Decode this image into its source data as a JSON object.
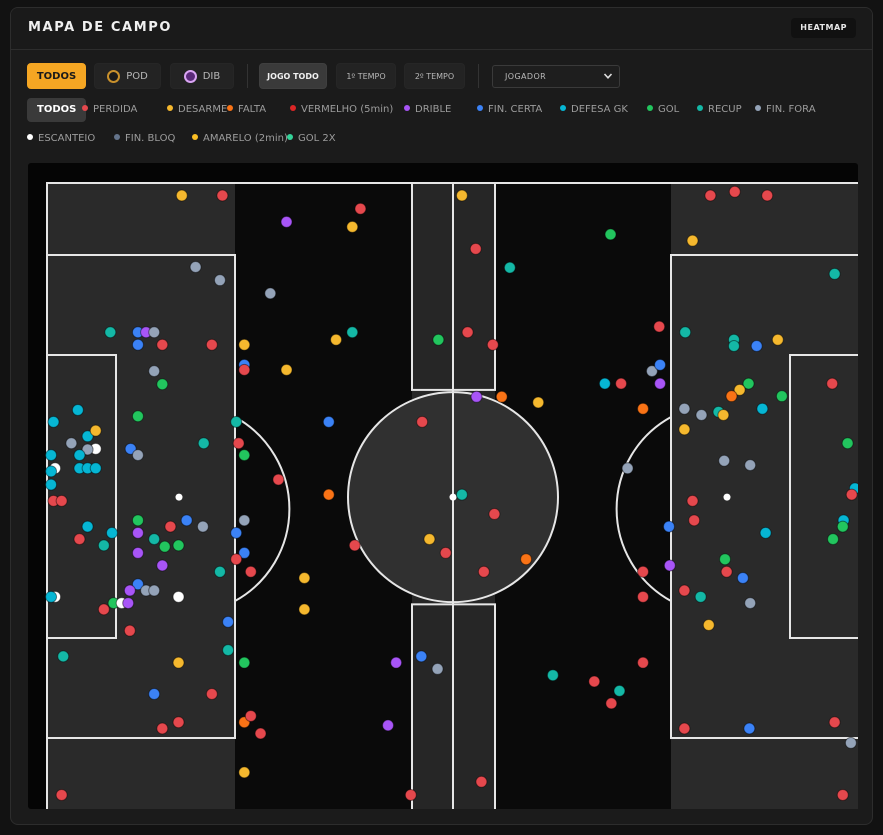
{
  "header": {
    "title": "MAPA DE CAMPO",
    "heatmap_label": "HEATMAP"
  },
  "teams": [
    {
      "label": "TODOS",
      "active": true
    },
    {
      "label": "POD",
      "active": false,
      "logo_color": "#c8902c"
    },
    {
      "label": "DIB",
      "active": false,
      "logo_color": "#b06ad8"
    }
  ],
  "periods": [
    {
      "label": "JOGO TODO",
      "active": true
    },
    {
      "label": "1º TEMPO",
      "active": false
    },
    {
      "label": "2º TEMPO",
      "active": false
    }
  ],
  "player_select": {
    "value": "JOGADOR"
  },
  "filters": [
    {
      "label": "TODOS",
      "active": true
    },
    {
      "label": "PERDIDA",
      "color": "#e5484d"
    },
    {
      "label": "DESARME",
      "color": "#f5b82e"
    },
    {
      "label": "FALTA",
      "color": "#f97316"
    },
    {
      "label": "VERMELHO (5min)",
      "color": "#dc2626"
    },
    {
      "label": "DRIBLE",
      "color": "#a855f7"
    },
    {
      "label": "FIN. CERTA",
      "color": "#3b82f6"
    },
    {
      "label": "DEFESA GK",
      "color": "#06b6d4"
    },
    {
      "label": "GOL",
      "color": "#22c55e"
    },
    {
      "label": "RECUP",
      "color": "#14b8a6"
    },
    {
      "label": "FIN. FORA",
      "color": "#94a3b8"
    },
    {
      "label": "ESCANTEIO",
      "color": "#ffffff"
    },
    {
      "label": "FIN. BLOQ",
      "color": "#64748b"
    },
    {
      "label": "AMARELO (2min)",
      "color": "#fbbf24"
    },
    {
      "label": "GOL 2X",
      "color": "#34d399"
    }
  ],
  "colors": {
    "perdida": "#e5484d",
    "desarme": "#f5b82e",
    "falta": "#f97316",
    "drible": "#a855f7",
    "fin_certa": "#3b82f6",
    "defesa_gk": "#06b6d4",
    "gol": "#22c55e",
    "recup": "#14b8a6",
    "fin_fora": "#94a3b8",
    "escanteio": "#ffffff",
    "fin_bloq": "#64748b",
    "amarelo": "#fbbf24",
    "gol2x": "#34d399"
  },
  "events": [
    [
      "desarme",
      0.166,
      0.02
    ],
    [
      "perdida",
      0.216,
      0.02
    ],
    [
      "drible",
      0.295,
      0.062
    ],
    [
      "perdida",
      0.386,
      0.041
    ],
    [
      "desarme",
      0.376,
      0.07
    ],
    [
      "desarme",
      0.511,
      0.02
    ],
    [
      "perdida",
      0.528,
      0.105
    ],
    [
      "recup",
      0.57,
      0.135
    ],
    [
      "gol",
      0.694,
      0.082
    ],
    [
      "perdida",
      0.817,
      0.02
    ],
    [
      "perdida",
      0.847,
      0.014
    ],
    [
      "perdida",
      0.887,
      0.02
    ],
    [
      "desarme",
      0.795,
      0.092
    ],
    [
      "recup",
      0.97,
      0.145
    ],
    [
      "fin_fora",
      0.183,
      0.134
    ],
    [
      "fin_fora",
      0.213,
      0.155
    ],
    [
      "fin_fora",
      0.275,
      0.176
    ],
    [
      "recup",
      0.078,
      0.238
    ],
    [
      "fin_certa",
      0.112,
      0.238
    ],
    [
      "drible",
      0.122,
      0.238
    ],
    [
      "fin_fora",
      0.132,
      0.238
    ],
    [
      "fin_certa",
      0.112,
      0.258
    ],
    [
      "perdida",
      0.142,
      0.258
    ],
    [
      "perdida",
      0.203,
      0.258
    ],
    [
      "desarme",
      0.243,
      0.258
    ],
    [
      "desarme",
      0.356,
      0.25
    ],
    [
      "recup",
      0.376,
      0.238
    ],
    [
      "gol",
      0.482,
      0.25
    ],
    [
      "perdida",
      0.518,
      0.238
    ],
    [
      "perdida",
      0.549,
      0.258
    ],
    [
      "perdida",
      0.754,
      0.229
    ],
    [
      "recup",
      0.786,
      0.238
    ],
    [
      "recup",
      0.846,
      0.25
    ],
    [
      "recup",
      0.846,
      0.26
    ],
    [
      "fin_certa",
      0.874,
      0.26
    ],
    [
      "desarme",
      0.9,
      0.25
    ],
    [
      "fin_certa",
      0.243,
      0.29
    ],
    [
      "perdida",
      0.243,
      0.298
    ],
    [
      "desarme",
      0.295,
      0.298
    ],
    [
      "fin_fora",
      0.132,
      0.3
    ],
    [
      "gol",
      0.142,
      0.321
    ],
    [
      "defesa_gk",
      0.687,
      0.32
    ],
    [
      "perdida",
      0.707,
      0.32
    ],
    [
      "fin_fora",
      0.745,
      0.3
    ],
    [
      "fin_certa",
      0.755,
      0.29
    ],
    [
      "drible",
      0.755,
      0.32
    ],
    [
      "gol",
      0.864,
      0.32
    ],
    [
      "desarme",
      0.853,
      0.33
    ],
    [
      "falta",
      0.843,
      0.34
    ],
    [
      "gol",
      0.905,
      0.34
    ],
    [
      "perdida",
      0.967,
      0.32
    ],
    [
      "drible",
      0.529,
      0.341
    ],
    [
      "falta",
      0.56,
      0.341
    ],
    [
      "desarme",
      0.605,
      0.35
    ],
    [
      "defesa_gk",
      0.008,
      0.381
    ],
    [
      "defesa_gk",
      0.038,
      0.362
    ],
    [
      "gol",
      0.112,
      0.372
    ],
    [
      "recup",
      0.233,
      0.381
    ],
    [
      "fin_certa",
      0.347,
      0.381
    ],
    [
      "perdida",
      0.462,
      0.381
    ],
    [
      "falta",
      0.734,
      0.36
    ],
    [
      "fin_fora",
      0.785,
      0.36
    ],
    [
      "fin_fora",
      0.806,
      0.37
    ],
    [
      "recup",
      0.827,
      0.365
    ],
    [
      "desarme",
      0.833,
      0.37
    ],
    [
      "defesa_gk",
      0.881,
      0.36
    ],
    [
      "escanteio",
      0.06,
      0.424
    ],
    [
      "defesa_gk",
      0.05,
      0.404
    ],
    [
      "fin_fora",
      0.03,
      0.415
    ],
    [
      "fin_fora",
      0.05,
      0.425
    ],
    [
      "desarme",
      0.06,
      0.395
    ],
    [
      "recup",
      0.193,
      0.415
    ],
    [
      "perdida",
      0.236,
      0.415
    ],
    [
      "fin_certa",
      0.103,
      0.424
    ],
    [
      "fin_fora",
      0.112,
      0.434
    ],
    [
      "gol",
      0.243,
      0.434
    ],
    [
      "defesa_gk",
      0.005,
      0.434
    ],
    [
      "defesa_gk",
      0.04,
      0.434
    ],
    [
      "defesa_gk",
      0.04,
      0.455
    ],
    [
      "defesa_gk",
      0.05,
      0.455
    ],
    [
      "defesa_gk",
      0.06,
      0.455
    ],
    [
      "escanteio",
      0.01,
      0.455
    ],
    [
      "defesa_gk",
      0.005,
      0.46
    ],
    [
      "fin_fora",
      0.715,
      0.455
    ],
    [
      "fin_fora",
      0.834,
      0.443
    ],
    [
      "fin_fora",
      0.866,
      0.45
    ],
    [
      "desarme",
      0.785,
      0.393
    ],
    [
      "gol",
      0.986,
      0.415
    ],
    [
      "perdida",
      0.285,
      0.473
    ],
    [
      "falta",
      0.347,
      0.497
    ],
    [
      "recup",
      0.511,
      0.497
    ],
    [
      "perdida",
      0.551,
      0.528
    ],
    [
      "perdida",
      0.795,
      0.507
    ],
    [
      "perdida",
      0.797,
      0.538
    ],
    [
      "defesa_gk",
      0.995,
      0.487
    ],
    [
      "perdida",
      0.991,
      0.497
    ],
    [
      "defesa_gk",
      0.005,
      0.481
    ],
    [
      "perdida",
      0.008,
      0.507
    ],
    [
      "perdida",
      0.018,
      0.507
    ],
    [
      "defesa_gk",
      0.05,
      0.548
    ],
    [
      "fin_certa",
      0.172,
      0.538
    ],
    [
      "fin_fora",
      0.192,
      0.548
    ],
    [
      "fin_certa",
      0.233,
      0.558
    ],
    [
      "fin_fora",
      0.243,
      0.538
    ],
    [
      "perdida",
      0.152,
      0.548
    ],
    [
      "gol",
      0.112,
      0.538
    ],
    [
      "drible",
      0.112,
      0.558
    ],
    [
      "defesa_gk",
      0.08,
      0.558
    ],
    [
      "recup",
      0.07,
      0.578
    ],
    [
      "perdida",
      0.04,
      0.568
    ],
    [
      "gol",
      0.162,
      0.578
    ],
    [
      "recup",
      0.132,
      0.568
    ],
    [
      "gol",
      0.145,
      0.58
    ],
    [
      "drible",
      0.112,
      0.59
    ],
    [
      "desarme",
      0.471,
      0.568
    ],
    [
      "perdida",
      0.379,
      0.578
    ],
    [
      "fin_certa",
      0.766,
      0.548
    ],
    [
      "defesa_gk",
      0.885,
      0.558
    ],
    [
      "defesa_gk",
      0.981,
      0.538
    ],
    [
      "gol",
      0.98,
      0.548
    ],
    [
      "gol",
      0.968,
      0.568
    ],
    [
      "fin_certa",
      0.243,
      0.59
    ],
    [
      "drible",
      0.142,
      0.61
    ],
    [
      "perdida",
      0.233,
      0.6
    ],
    [
      "perdida",
      0.251,
      0.62
    ],
    [
      "recup",
      0.213,
      0.62
    ],
    [
      "desarme",
      0.317,
      0.63
    ],
    [
      "perdida",
      0.491,
      0.59
    ],
    [
      "perdida",
      0.538,
      0.62
    ],
    [
      "falta",
      0.59,
      0.6
    ],
    [
      "drible",
      0.767,
      0.61
    ],
    [
      "perdida",
      0.734,
      0.62
    ],
    [
      "gol",
      0.835,
      0.6
    ],
    [
      "perdida",
      0.837,
      0.62
    ],
    [
      "fin_certa",
      0.857,
      0.63
    ],
    [
      "fin_certa",
      0.112,
      0.64
    ],
    [
      "fin_fora",
      0.122,
      0.65
    ],
    [
      "fin_fora",
      0.132,
      0.65
    ],
    [
      "drible",
      0.102,
      0.65
    ],
    [
      "escanteio",
      0.162,
      0.66
    ],
    [
      "escanteio",
      0.01,
      0.66
    ],
    [
      "defesa_gk",
      0.005,
      0.66
    ],
    [
      "gol",
      0.082,
      0.67
    ],
    [
      "escanteio",
      0.092,
      0.67
    ],
    [
      "drible",
      0.1,
      0.67
    ],
    [
      "perdida",
      0.07,
      0.68
    ],
    [
      "desarme",
      0.317,
      0.68
    ],
    [
      "perdida",
      0.734,
      0.66
    ],
    [
      "perdida",
      0.785,
      0.65
    ],
    [
      "recup",
      0.805,
      0.66
    ],
    [
      "fin_fora",
      0.866,
      0.67
    ],
    [
      "desarme",
      0.815,
      0.705
    ],
    [
      "perdida",
      0.102,
      0.714
    ],
    [
      "fin_certa",
      0.223,
      0.7
    ],
    [
      "recup",
      0.223,
      0.745
    ],
    [
      "recup",
      0.02,
      0.755
    ],
    [
      "desarme",
      0.162,
      0.765
    ],
    [
      "gol",
      0.243,
      0.765
    ],
    [
      "drible",
      0.43,
      0.765
    ],
    [
      "fin_certa",
      0.461,
      0.755
    ],
    [
      "fin_fora",
      0.481,
      0.775
    ],
    [
      "recup",
      0.623,
      0.785
    ],
    [
      "perdida",
      0.674,
      0.795
    ],
    [
      "recup",
      0.705,
      0.81
    ],
    [
      "perdida",
      0.734,
      0.765
    ],
    [
      "fin_certa",
      0.132,
      0.815
    ],
    [
      "perdida",
      0.203,
      0.815
    ],
    [
      "perdida",
      0.142,
      0.87
    ],
    [
      "perdida",
      0.162,
      0.86
    ],
    [
      "falta",
      0.243,
      0.86
    ],
    [
      "perdida",
      0.251,
      0.85
    ],
    [
      "perdida",
      0.263,
      0.878
    ],
    [
      "drible",
      0.42,
      0.865
    ],
    [
      "perdida",
      0.695,
      0.83
    ],
    [
      "perdida",
      0.785,
      0.87
    ],
    [
      "fin_certa",
      0.865,
      0.87
    ],
    [
      "perdida",
      0.97,
      0.86
    ],
    [
      "fin_fora",
      0.99,
      0.893
    ],
    [
      "desarme",
      0.243,
      0.94
    ],
    [
      "perdida",
      0.018,
      0.976
    ],
    [
      "perdida",
      0.448,
      0.976
    ],
    [
      "perdida",
      0.535,
      0.955
    ],
    [
      "perdida",
      0.98,
      0.976
    ]
  ]
}
